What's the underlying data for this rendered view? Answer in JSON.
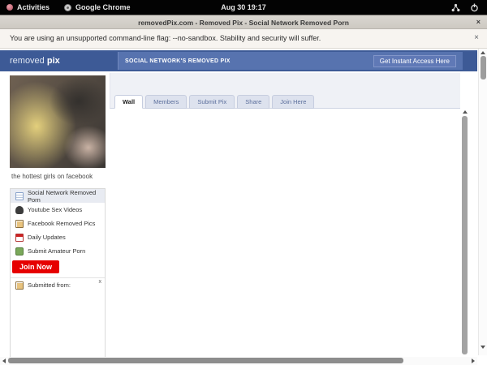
{
  "desktop": {
    "activities": "Activities",
    "app": "Google Chrome",
    "clock": "Aug 30  19:17"
  },
  "window": {
    "title": "removedPix.com - Removed Pix - Social Network Removed Porn",
    "close": "×"
  },
  "infobar": {
    "message": "You are using an unsupported command-line flag: --no-sandbox. Stability and security will suffer.",
    "close": "×"
  },
  "site": {
    "brand_left": "removed ",
    "brand_right": "pix",
    "banner": "SOCIAL NETWORK'S REMOVED PIX",
    "cta": "Get Instant Access Here",
    "colors": {
      "header_blue": "#3d5a96",
      "inner_bar_blue": "#5773af",
      "join_now_red": "#e60000",
      "active_row_highlight": "#e8ebf2"
    }
  },
  "tabs": {
    "items": [
      {
        "label": "Wall",
        "active": true
      },
      {
        "label": "Members",
        "active": false
      },
      {
        "label": "Submit Pix",
        "active": false
      },
      {
        "label": "Share",
        "active": false
      },
      {
        "label": "Join Here",
        "active": false
      }
    ]
  },
  "sidebar": {
    "caption": "the hottest girls on facebook",
    "menu": [
      {
        "label": "Social Network Removed Porn",
        "icon": "note-icon"
      },
      {
        "label": "Youtube Sex Videos",
        "icon": "webcam-icon"
      },
      {
        "label": "Facebook Removed Pics",
        "icon": "photo-icon"
      },
      {
        "label": "Daily Updates",
        "icon": "calendar-icon"
      },
      {
        "label": "Submit Amateur Porn",
        "icon": "camera-icon"
      }
    ],
    "join_button": "Join Now",
    "submitted_from": {
      "label": "Submitted from:",
      "close": "x"
    }
  }
}
